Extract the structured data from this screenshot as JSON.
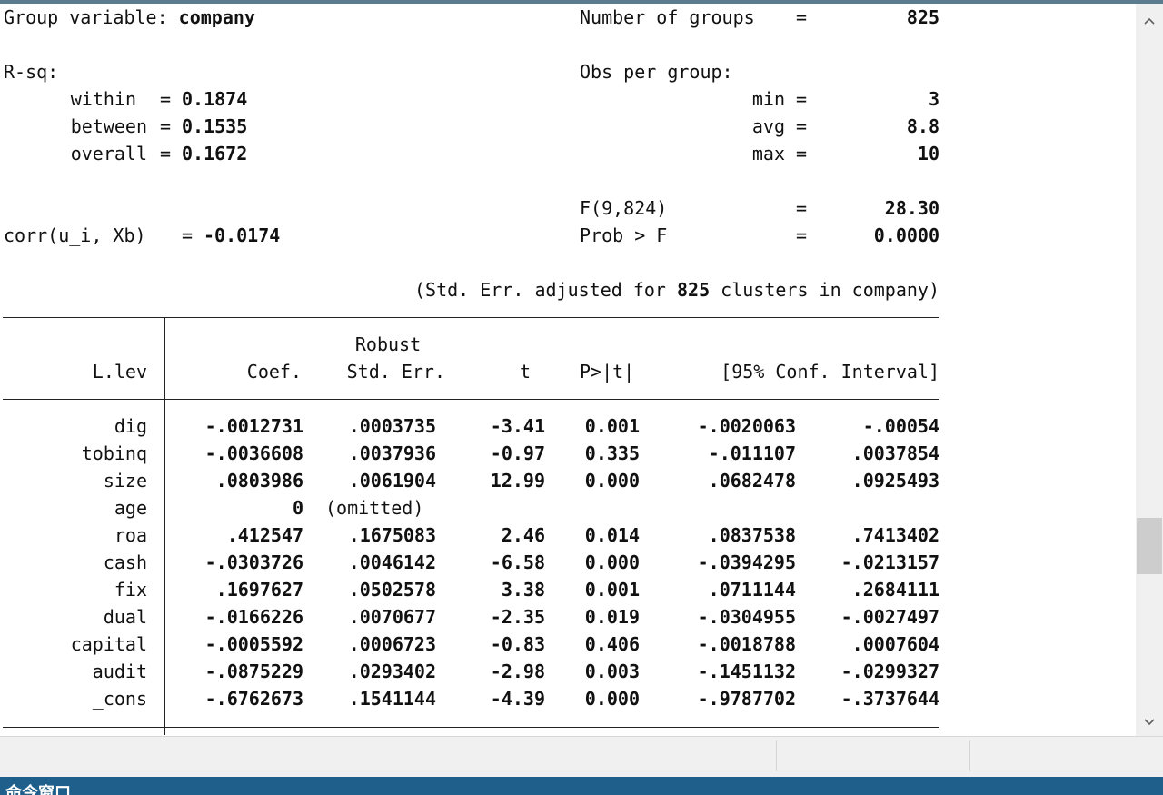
{
  "header": {
    "group_var_label": "Group variable: ",
    "group_var_value": "company",
    "num_groups_label": "Number of groups",
    "num_groups_eq": "=",
    "num_groups_value": "825",
    "rsq_label": "R-sq:",
    "obs_label": "Obs per group:",
    "rsq": [
      {
        "label": "within",
        "eq": "=",
        "value": "0.1874"
      },
      {
        "label": "between",
        "eq": "=",
        "value": "0.1535"
      },
      {
        "label": "overall",
        "eq": "=",
        "value": "0.1672"
      }
    ],
    "obs": [
      {
        "label": "min",
        "eq": "=",
        "value": "3"
      },
      {
        "label": "avg",
        "eq": "=",
        "value": "8.8"
      },
      {
        "label": "max",
        "eq": "=",
        "value": "10"
      }
    ],
    "f_label": "F(9,824)",
    "f_eq": "=",
    "f_value": "28.30",
    "corr_label": "corr(u_i, Xb)",
    "corr_eq": "=",
    "corr_value": "-0.0174",
    "prob_label": "Prob > F",
    "prob_eq": "=",
    "prob_value": "0.0000",
    "cluster_note_pre": "(Std. Err. adjusted for ",
    "cluster_note_num": "825",
    "cluster_note_post": " clusters in company)"
  },
  "table": {
    "depvar": "L.lev",
    "robust_label": "Robust",
    "columns": {
      "coef": "Coef.",
      "se": "Std. Err.",
      "t": "t",
      "p": "P>|t|",
      "ci": "[95% Conf. Interval]"
    },
    "rows": [
      {
        "var": "dig",
        "coef": "-.0012731",
        "se": ".0003735",
        "t": "-3.41",
        "p": "0.001",
        "lo": "-.0020063",
        "hi": "-.00054"
      },
      {
        "var": "tobinq",
        "coef": "-.0036608",
        "se": ".0037936",
        "t": "-0.97",
        "p": "0.335",
        "lo": "-.011107",
        "hi": ".0037854"
      },
      {
        "var": "size",
        "coef": ".0803986",
        "se": ".0061904",
        "t": "12.99",
        "p": "0.000",
        "lo": ".0682478",
        "hi": ".0925493"
      },
      {
        "var": "age",
        "coef": "0",
        "se": "(omitted)",
        "t": "",
        "p": "",
        "lo": "",
        "hi": ""
      },
      {
        "var": "roa",
        "coef": ".412547",
        "se": ".1675083",
        "t": "2.46",
        "p": "0.014",
        "lo": ".0837538",
        "hi": ".7413402"
      },
      {
        "var": "cash",
        "coef": "-.0303726",
        "se": ".0046142",
        "t": "-6.58",
        "p": "0.000",
        "lo": "-.0394295",
        "hi": "-.0213157"
      },
      {
        "var": "fix",
        "coef": ".1697627",
        "se": ".0502578",
        "t": "3.38",
        "p": "0.001",
        "lo": ".0711144",
        "hi": ".2684111"
      },
      {
        "var": "dual",
        "coef": "-.0166226",
        "se": ".0070677",
        "t": "-2.35",
        "p": "0.019",
        "lo": "-.0304955",
        "hi": "-.0027497"
      },
      {
        "var": "capital",
        "coef": "-.0005592",
        "se": ".0006723",
        "t": "-0.83",
        "p": "0.406",
        "lo": "-.0018788",
        "hi": ".0007604"
      },
      {
        "var": "audit",
        "coef": "-.0875229",
        "se": ".0293402",
        "t": "-2.98",
        "p": "0.003",
        "lo": "-.1451132",
        "hi": "-.0299327"
      },
      {
        "var": "_cons",
        "coef": "-.6762673",
        "se": ".1541144",
        "t": "-4.39",
        "p": "0.000",
        "lo": "-.9787702",
        "hi": "-.3737644"
      }
    ]
  },
  "scrollbar": {
    "up_icon": "chevron-up-icon",
    "down_icon": "chevron-down-icon",
    "up_glyph": "⌃",
    "down_glyph": "⌄"
  },
  "bottom": {
    "title": "命令窗口"
  },
  "colors": {
    "accent_bar": "#1f5f8b",
    "top_strip": "#5b7b8e"
  }
}
